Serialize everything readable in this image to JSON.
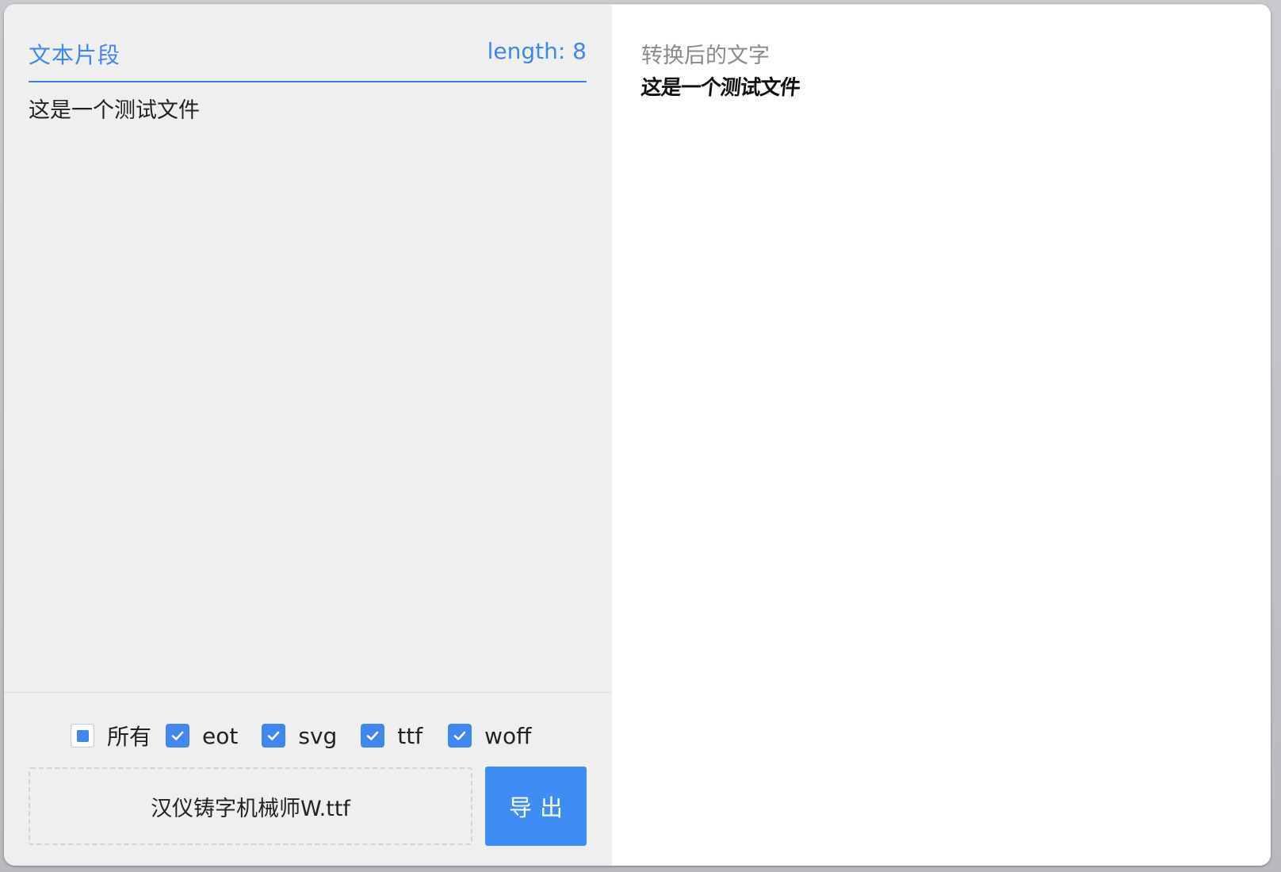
{
  "source": {
    "title": "文本片段",
    "length_label": "length: 8",
    "text": "这是一个测试文件"
  },
  "formats": {
    "all_label": "所有",
    "items": [
      {
        "label": "eot",
        "checked": true
      },
      {
        "label": "svg",
        "checked": true
      },
      {
        "label": "ttf",
        "checked": true
      },
      {
        "label": "woff",
        "checked": true
      }
    ]
  },
  "file": {
    "name": "汉仪铸字机械师W.ttf"
  },
  "export": {
    "label": "导出"
  },
  "result": {
    "title": "转换后的文字",
    "text": "这是一个测试文件"
  },
  "colors": {
    "accent": "#3f86f0",
    "panel_bg": "#efeff0"
  }
}
